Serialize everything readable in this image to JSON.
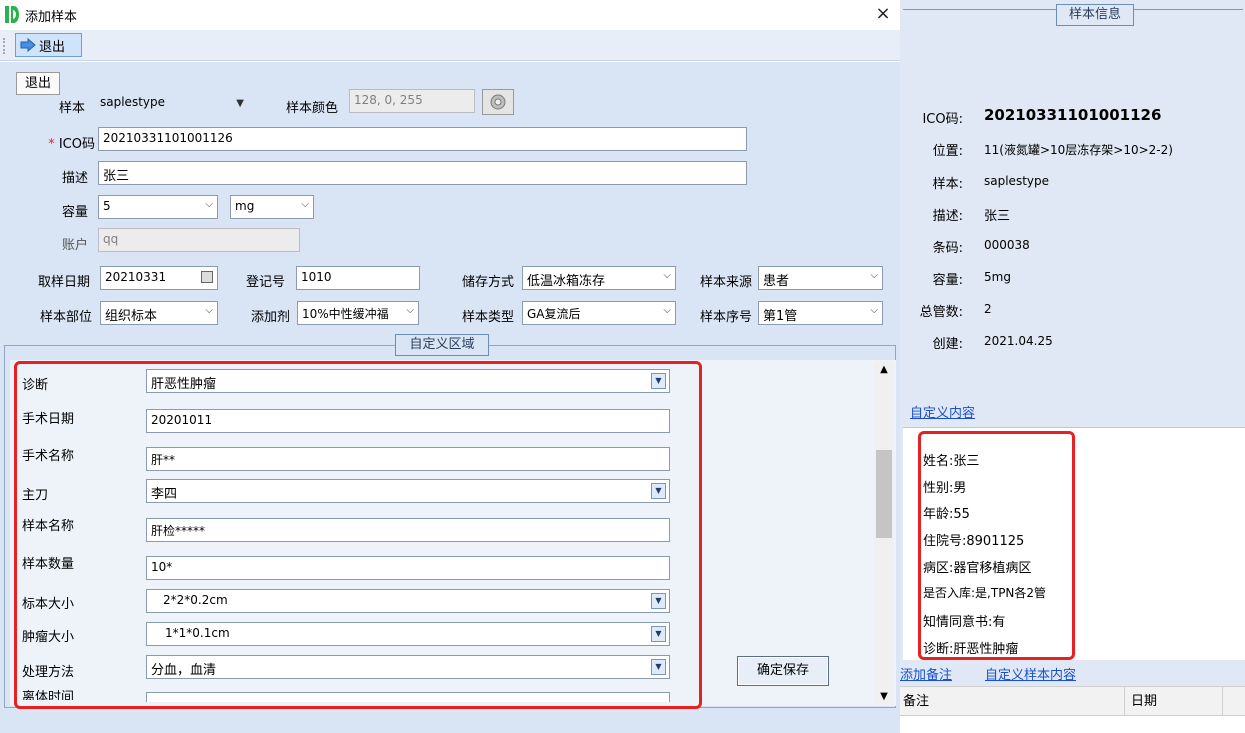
{
  "window": {
    "title": "添加样本",
    "close_icon": "×"
  },
  "toolbar": {
    "exit_label": "退出"
  },
  "form": {
    "exit_label": "退出",
    "sample_label": "样本",
    "sample_value": "saplestype",
    "sample_color_label": "样本颜色",
    "sample_color_value": "128, 0, 255",
    "ico_label": "ICO码",
    "ico_required": "*",
    "ico_value": "20210331101001126",
    "desc_label": "描述",
    "desc_value": "张三",
    "volume_label": "容量",
    "volume_value": "5",
    "unit_value": "mg",
    "account_label": "账户",
    "account_value": "qq",
    "sample_date_label": "取样日期",
    "sample_date_value": "20210331",
    "reg_no_label": "登记号",
    "reg_no_value": "1010",
    "storage_label": "储存方式",
    "storage_value": "低温冰箱冻存",
    "source_label": "样本来源",
    "source_value": "患者",
    "part_label": "样本部位",
    "part_value": "组织标本",
    "additive_label": "添加剂",
    "additive_value": "10%中性缓冲福",
    "type_label": "样本类型",
    "type_value": "GA复流后",
    "seq_label": "样本序号",
    "seq_value": "第1管"
  },
  "custom_area": {
    "legend": "自定义区域",
    "rows": [
      {
        "label": "诊断",
        "value": "肝恶性肿瘤",
        "dropdown": true
      },
      {
        "label": "手术日期",
        "value": "20201011",
        "dropdown": false
      },
      {
        "label": "手术名称",
        "value": "肝**",
        "dropdown": false
      },
      {
        "label": "主刀",
        "value": "李四",
        "dropdown": true
      },
      {
        "label": "样本名称",
        "value": "肝检*****",
        "dropdown": false
      },
      {
        "label": "样本数量",
        "value": "10*",
        "dropdown": false
      },
      {
        "label": "标本大小",
        "value": "2*2*0.2cm",
        "dropdown": true
      },
      {
        "label": "肿瘤大小",
        "value": "1*1*0.1cm",
        "dropdown": true
      },
      {
        "label": "处理方法",
        "value": "分血，血清",
        "dropdown": true
      },
      {
        "label": "离体时间",
        "value": "",
        "dropdown": false
      }
    ],
    "save_label": "确定保存"
  },
  "info": {
    "legend": "样本信息",
    "ico_label": "ICO码:",
    "ico_value": "20210331101001126",
    "location_label": "位置:",
    "location_value": "11(液氮罐>10层冻存架>10>2-2)",
    "sample_label": "样本:",
    "sample_value": "saplestype",
    "desc_label": "描述:",
    "desc_value": "张三",
    "barcode_label": "条码:",
    "barcode_value": "000038",
    "volume_label": "容量:",
    "volume_value": "5mg",
    "tubes_label": "总管数:",
    "tubes_value": "2",
    "created_label": "创建:",
    "created_value": "2021.04.25"
  },
  "custom_content": {
    "link_label": "自定义内容",
    "lines": [
      "姓名:张三",
      "性别:男",
      "年龄:55",
      "住院号:8901125",
      "病区:器官移植病区",
      "是否入库:是,TPN各2管",
      "知情同意书:有",
      "诊断:肝恶性肿瘤"
    ]
  },
  "tabs": {
    "add_note": "添加备注",
    "custom_sample": "自定义样本内容"
  },
  "grid": {
    "col_note": "备注",
    "col_date": "日期"
  },
  "colors": {
    "accent": "#e52222",
    "link": "#1a4fd0",
    "panel_bg": "#d9e5f4"
  }
}
